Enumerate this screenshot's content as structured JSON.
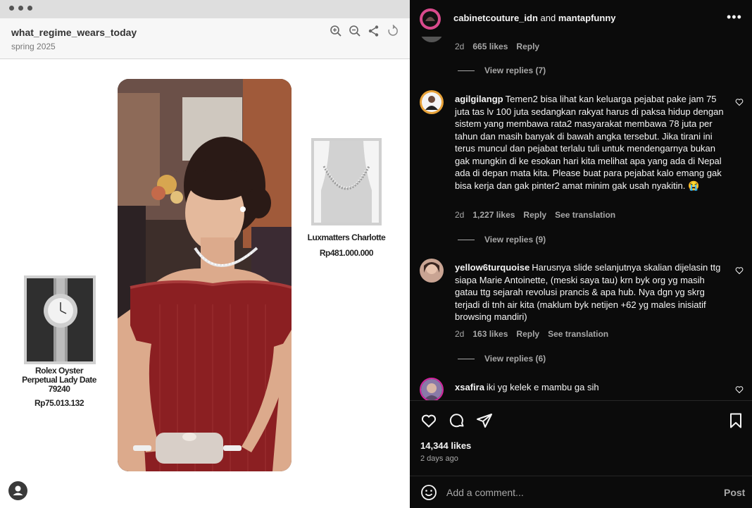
{
  "post": {
    "title": "what_regime_wears_today",
    "subtitle": "spring 2025",
    "products": [
      {
        "name": "Luxmatters Charlotte",
        "price": "Rp481.000.000"
      },
      {
        "name_lines": [
          "Rolex Oyster",
          "Perpetual Lady Date",
          "79240"
        ],
        "price": "Rp75.013.132"
      }
    ]
  },
  "header": {
    "user1": "cabinetcouture_idn",
    "and": "and",
    "user2": "mantapfunny"
  },
  "comments": {
    "prev_meta": {
      "time": "2d",
      "likes": "665 likes",
      "reply": "Reply"
    },
    "prev_view_replies": "View replies (7)",
    "items": [
      {
        "username": "agilgilangp",
        "text": "Temen2 bisa lihat kan keluarga pejabat pake jam 75 juta tas lv 100 juta sedangkan rakyat harus di paksa hidup dengan sistem yang membawa rata2 masyarakat membawa 78 juta per tahun dan masih banyak di bawah angka tersebut. Jika tirani ini terus muncul dan pejabat terlalu tuli untuk mendengarnya bukan gak mungkin di ke esokan hari kita melihat apa yang ada di Nepal ada di depan mata kita. Please buat para pejabat kalo emang gak bisa kerja dan gak pinter2 amat minim gak usah nyakitin. 😭",
        "time": "2d",
        "likes": "1,227 likes",
        "reply": "Reply",
        "translate": "See translation",
        "view_replies": "View replies (9)"
      },
      {
        "username": "yellow6turquoise",
        "text": "Harusnya slide selanjutnya skalian dijelasin ttg siapa Marie Antoinette, (meski saya tau) krn byk org yg masih gatau ttg sejarah revolusi prancis & apa hub. Nya dgn yg skrg terjadi di tnh air kita (maklum byk netijen +62 yg males inisiatif browsing mandiri)",
        "time": "2d",
        "likes": "163 likes",
        "reply": "Reply",
        "translate": "See translation",
        "view_replies": "View replies (6)"
      },
      {
        "username": "xsafira",
        "text": "iki yg kelek e mambu ga sih"
      }
    ]
  },
  "actions": {
    "likes": "14,344 likes",
    "time_ago": "2 days ago"
  },
  "add_comment": {
    "placeholder": "Add a comment...",
    "post_label": "Post"
  },
  "colors": {
    "dark_bg": "#0b0b0b",
    "muted": "#a8a8a8",
    "dress": "#8b1f22"
  }
}
